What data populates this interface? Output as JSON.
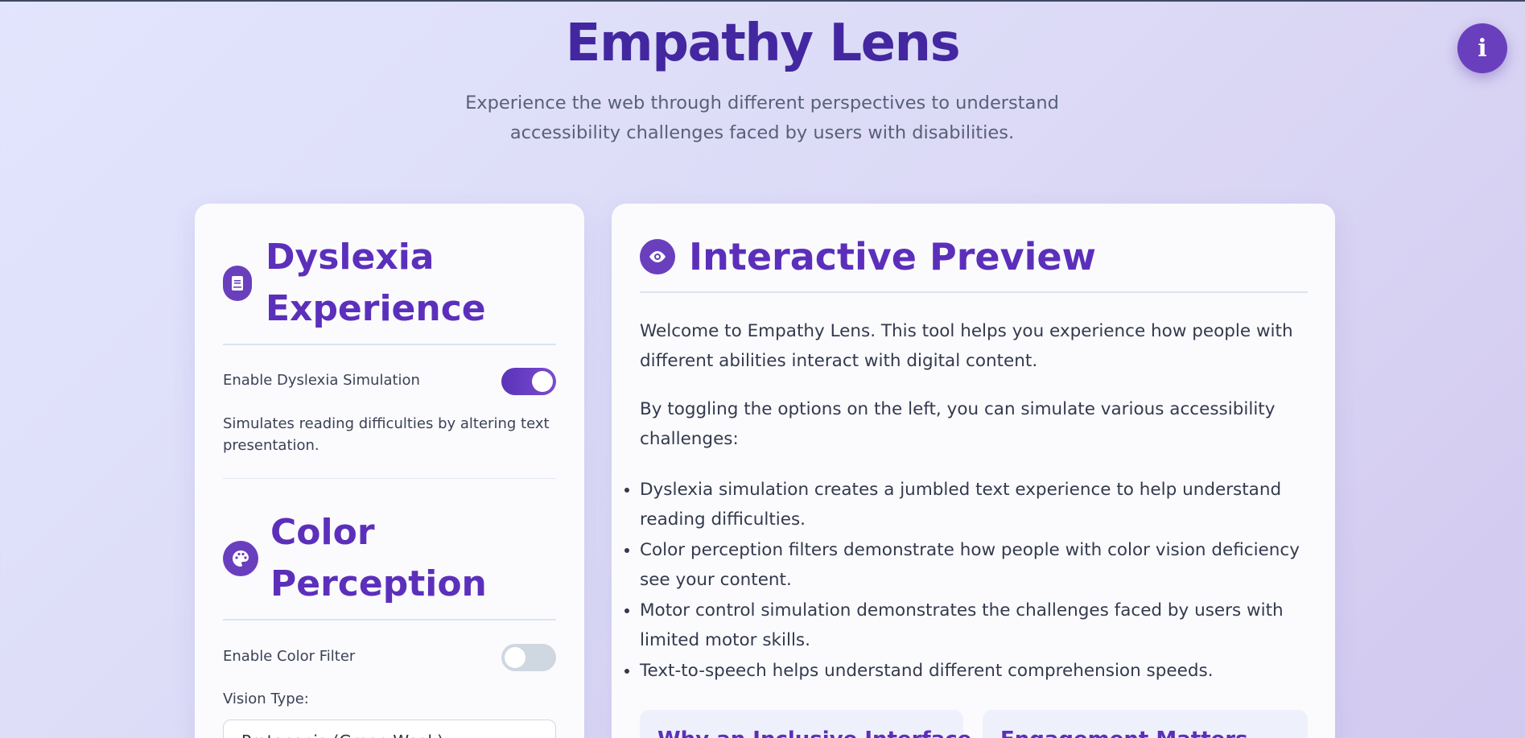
{
  "header": {
    "title": "Empathy Lens",
    "subtitle": "Experience the web through different perspectives to understand accessibility challenges faced by users with disabilities."
  },
  "info_button": {
    "label": "i"
  },
  "sidebar": {
    "dyslexia": {
      "title_line1": "Dyslexia",
      "title_line2": "Experience",
      "icon": "book-icon",
      "toggle_label": "Enable Dyslexia Simulation",
      "toggle_on": true,
      "description": "Simulates reading difficulties by altering text presentation."
    },
    "color": {
      "title_line1": "Color",
      "title_line2": "Perception",
      "icon": "palette-icon",
      "toggle_label": "Enable Color Filter",
      "toggle_on": false,
      "vision_type_label": "Vision Type:",
      "vision_type_value": "Protanopia (Green-Weak)"
    }
  },
  "preview": {
    "title": "Interactive Preview",
    "icon": "eye-icon",
    "para1": "Welcome to Empathy Lens. This tool helps you experience how people with different abilities interact with digital content.",
    "para2": "By toggling the options on the left, you can simulate various accessibility challenges:",
    "bullets": [
      "Dyslexia simulation creates a jumbled text experience to help understand reading difficulties.",
      "Color perception filters demonstrate how people with color vision deficiency see your content.",
      "Motor control simulation demonstrates the challenges faced by users with limited motor skills.",
      "Text-to-speech helps understand different comprehension speeds."
    ],
    "mini_cards": [
      {
        "title": "Why an Inclusive Interface"
      },
      {
        "title": "Engagement Matters"
      }
    ]
  },
  "colors": {
    "accent": "#5c2fbb",
    "title": "#4327a0",
    "toggle_on": "#6a3fbd",
    "toggle_off": "#cfd7e1"
  }
}
